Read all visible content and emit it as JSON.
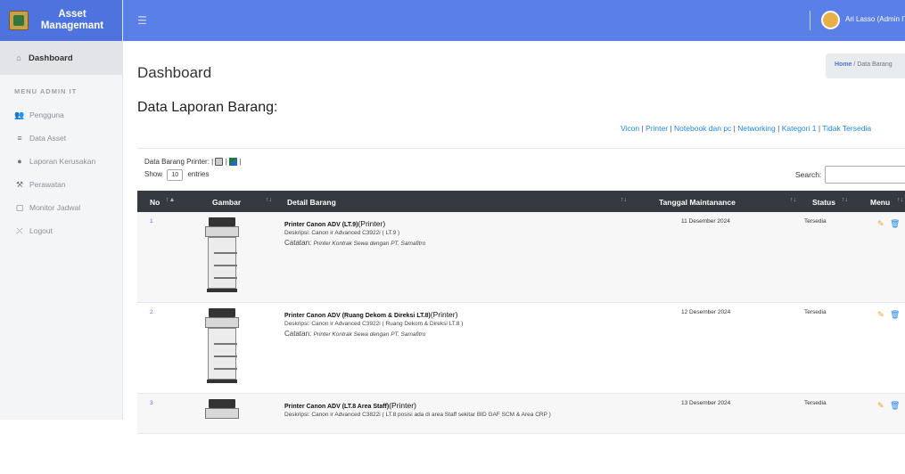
{
  "brand": {
    "line1": "Asset",
    "line2": "Managemant"
  },
  "sidebar": {
    "dashboard": "Dashboard",
    "section": "MENU ADMIN IT",
    "items": [
      {
        "label": "Pengguna",
        "icon": "users-icon"
      },
      {
        "label": "Data Asset",
        "icon": "database-icon"
      },
      {
        "label": "Laporan Kerusakan",
        "icon": "info-icon"
      },
      {
        "label": "Perawatan",
        "icon": "wrench-icon"
      },
      {
        "label": "Monitor Jadwal",
        "icon": "calendar-icon"
      },
      {
        "label": "Logout",
        "icon": "logout-icon"
      }
    ]
  },
  "topbar": {
    "user": "Ari Lasso (Admin IT"
  },
  "page": {
    "title": "Dashboard",
    "breadcrumb_home": "Home",
    "breadcrumb_sep": "/",
    "breadcrumb_current": "Data Barang",
    "section_title": "Data Laporan Barang:"
  },
  "categories": [
    "Vicon",
    "Printer",
    "Notebook dan pc",
    "Networking",
    "Kategori 1",
    "Tidak Tersedia"
  ],
  "table_controls": {
    "printer_label": "Data Barang Printer: |",
    "show": "Show",
    "entries_value": "10",
    "entries": "entries",
    "search": "Search:"
  },
  "columns": [
    "No",
    "Gambar",
    "Detail Barang",
    "Tanggal Maintanance",
    "Status",
    "Menu"
  ],
  "rows": [
    {
      "no": "1",
      "name": "Printer Canon ADV (LT.9)",
      "type": "(Printer)",
      "desc": "Deskripsi: Canon ir Advanced C3922i ( LT.9 )",
      "note_label": "Catatan:",
      "note": "Printer Kontrak Sewa dengan PT. Samafitro",
      "date": "11 Desember 2024",
      "status": "Tersedia"
    },
    {
      "no": "2",
      "name": "Printer Canon ADV (Ruang Dekom & Direksi LT.8)",
      "type": "(Printer)",
      "desc": "Deskripsi: Canon ir Advanced C3922i ( Ruang Dekom & Direksi LT.8 )",
      "note_label": "Catatan:",
      "note": "Printer Kontrak Sewa dengan PT. Samafitro",
      "date": "12 Desember 2024",
      "status": "Tersedia"
    },
    {
      "no": "3",
      "name": "Printer Canon ADV (LT.8 Area Staff)",
      "type": "(Printer)",
      "desc": "Deskripsi: Canon ir Advanced C3822i ( LT.8 posisi ada di area Staff sekitar BID GAF SCM & Area CRP )",
      "note_label": "",
      "note": "",
      "date": "13 Desember 2024",
      "status": "Tersedia"
    }
  ],
  "colors": {
    "primary": "#4e73df",
    "topbar": "#5a7fe6",
    "thead": "#343a40",
    "link": "#1e88e5"
  }
}
